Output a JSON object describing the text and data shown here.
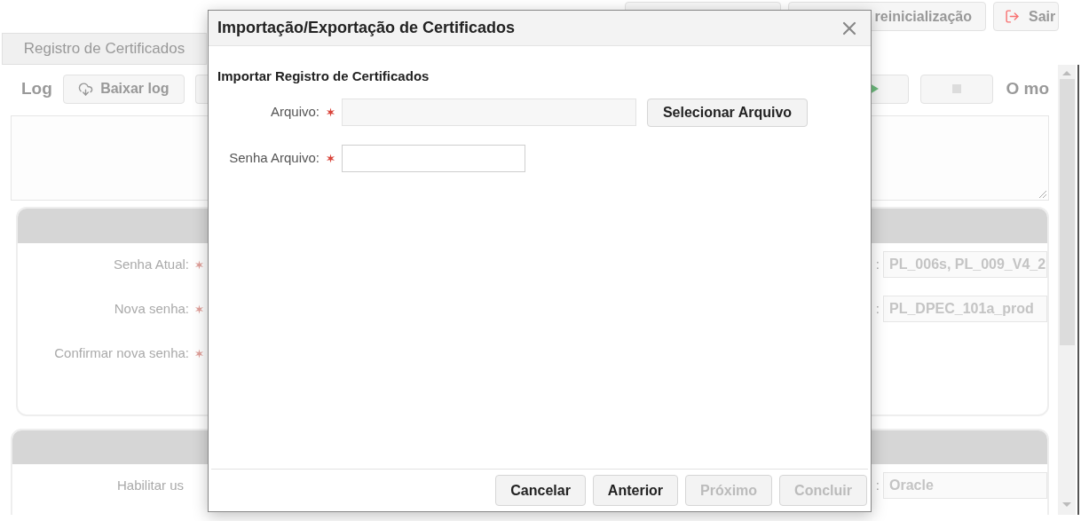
{
  "top_buttons": [
    {
      "kind": "blank"
    },
    {
      "kind": "text",
      "label": "reinicialização"
    },
    {
      "kind": "exit",
      "label": "Sair"
    }
  ],
  "tabs": [
    {
      "label": "Registro de Certificados"
    }
  ],
  "log": {
    "title": "Log",
    "buttons": [
      {
        "kind": "download",
        "label": "Baixar log"
      },
      {
        "kind": "blank"
      },
      {
        "kind": "play"
      },
      {
        "kind": "stop"
      }
    ],
    "status": "O mo"
  },
  "password_card": {
    "left_fields": [
      {
        "label": "Senha Atual:",
        "required": true
      },
      {
        "label": "Nova senha:",
        "required": true
      },
      {
        "label": "Confirmar nova senha:",
        "required": true
      }
    ],
    "right_fields": [
      {
        "label": ":",
        "value": "PL_006s, PL_009_V4_2"
      },
      {
        "label": ":",
        "value": "PL_DPEC_101a_prod"
      }
    ]
  },
  "database_card": {
    "left_fields": [
      {
        "label": "Habilitar us",
        "required": false
      }
    ],
    "right_fields": [
      {
        "label": ":",
        "value": "Oracle"
      }
    ]
  },
  "dialog": {
    "title": "Importação/Exportação de Certificados",
    "section_title": "Importar Registro de Certificados",
    "fields": [
      {
        "kind": "file",
        "label": "Arquivo:",
        "required": true,
        "button": "Selecionar Arquivo"
      },
      {
        "kind": "password",
        "label": "Senha Arquivo:",
        "required": true
      }
    ],
    "buttons": [
      {
        "label": "Cancelar",
        "disabled": false
      },
      {
        "label": "Anterior",
        "disabled": false
      },
      {
        "label": "Próximo",
        "disabled": true
      },
      {
        "label": "Concluir",
        "disabled": true
      }
    ]
  }
}
